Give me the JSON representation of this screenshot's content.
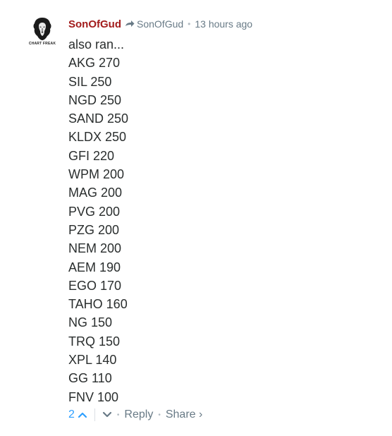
{
  "avatar": {
    "caption": "CHART FREAK"
  },
  "header": {
    "author": "SonOfGud",
    "parent_author": "SonOfGud",
    "separator": "•",
    "time": "13 hours ago"
  },
  "body": {
    "lines": [
      "also ran...",
      "AKG 270",
      "SIL 250",
      "NGD 250",
      "SAND 250",
      "KLDX 250",
      "GFI 220",
      "WPM 200",
      "MAG 200",
      "PVG 200",
      "PZG 200",
      "NEM 200",
      "AEM 190",
      "EGO 170",
      "TAHO 160",
      "NG 150",
      "TRQ 150",
      "XPL 140",
      "GG 110",
      "FNV 100"
    ]
  },
  "footer": {
    "upvotes": "2",
    "separator": "•",
    "reply_label": "Reply",
    "share_label": "Share ›"
  },
  "colors": {
    "author": "#a21b1b",
    "meta": "#687a86",
    "vote": "#2e9fff",
    "text": "#2a2e2e"
  },
  "icons": {
    "avatar": "lion-logo-icon",
    "reply": "reply-arrow-icon",
    "upvote": "chevron-up-icon",
    "downvote": "chevron-down-icon"
  }
}
